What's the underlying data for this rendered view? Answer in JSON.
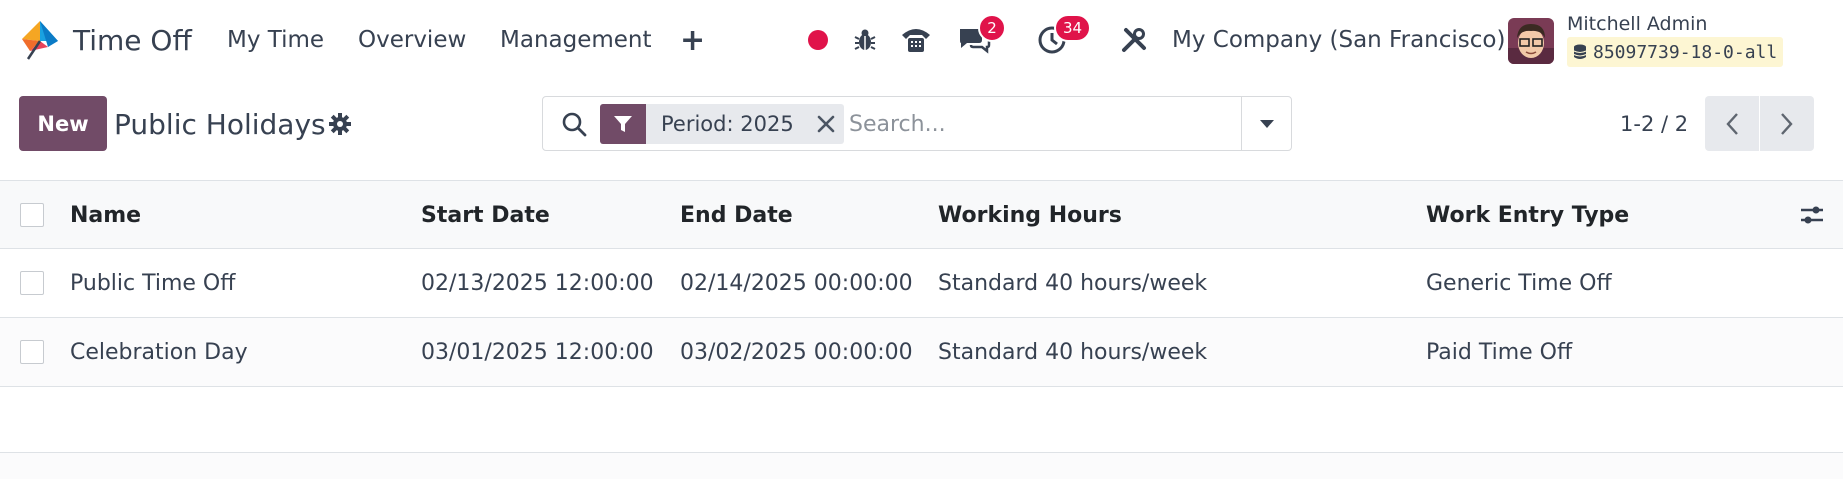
{
  "navbar": {
    "app_name": "Time Off",
    "menu": [
      "My Time",
      "Overview",
      "Management"
    ],
    "plus_label": "+",
    "messages_count": "2",
    "activities_count": "34",
    "company": "My Company (San Francisco)",
    "user_name": "Mitchell Admin",
    "database": "85097739-18-0-all"
  },
  "control_panel": {
    "new_label": "New",
    "title": "Public Holidays",
    "facet_label": "Period: 2025",
    "search_placeholder": "Search...",
    "pager": "1-2 / 2"
  },
  "list": {
    "columns": [
      "Name",
      "Start Date",
      "End Date",
      "Working Hours",
      "Work Entry Type"
    ],
    "rows": [
      {
        "name": "Public Time Off",
        "start": "02/13/2025 12:00:00",
        "end": "02/14/2025 00:00:00",
        "hours": "Standard 40 hours/week",
        "type": "Generic Time Off"
      },
      {
        "name": "Celebration Day",
        "start": "03/01/2025 12:00:00",
        "end": "03/02/2025 00:00:00",
        "hours": "Standard 40 hours/week",
        "type": "Paid Time Off"
      }
    ]
  },
  "colors": {
    "brand": "#714b67",
    "badge": "#e0134a",
    "record_dot": "#e0134a"
  }
}
